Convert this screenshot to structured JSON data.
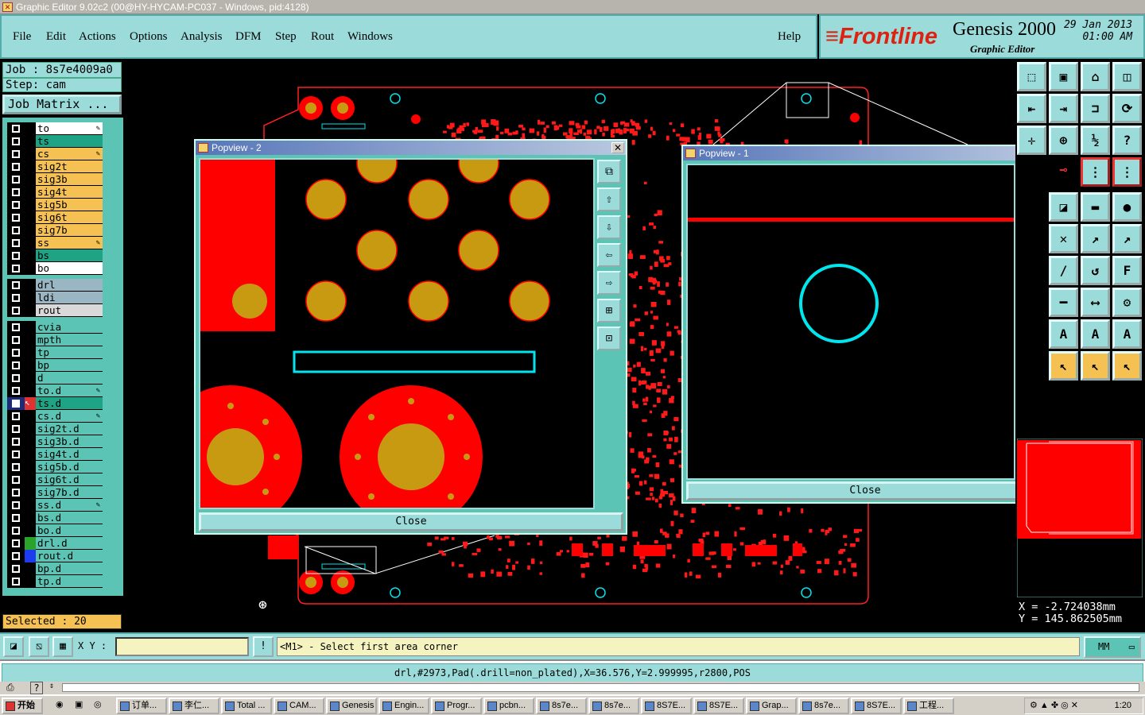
{
  "window": {
    "title": "Graphic Editor 9.02c2 (00@HY-HYCAM-PC037 - Windows, pid:4128)"
  },
  "menu": {
    "file": "File",
    "edit": "Edit",
    "actions": "Actions",
    "options": "Options",
    "analysis": "Analysis",
    "dfm": "DFM",
    "step": "Step",
    "rout": "Rout",
    "windows": "Windows",
    "help": "Help"
  },
  "brand": {
    "logo": "Frontline",
    "product": "Genesis 2000",
    "editor": "Graphic Editor",
    "date": "29 Jan 2013",
    "time": "01:00 AM"
  },
  "job": {
    "label": "Job : 8s7e4009a0",
    "step": "Step: cam",
    "matrix_button": "Job Matrix ..."
  },
  "layers_board": [
    {
      "name": "to",
      "color": "#ffffff",
      "pen": true
    },
    {
      "name": "ts",
      "color": "#1ea384",
      "pen": false
    },
    {
      "name": "cs",
      "color": "#f6c153",
      "pen": true
    },
    {
      "name": "sig2t",
      "color": "#f6c153",
      "pen": false
    },
    {
      "name": "sig3b",
      "color": "#f6c153",
      "pen": false
    },
    {
      "name": "sig4t",
      "color": "#f6c153",
      "pen": false
    },
    {
      "name": "sig5b",
      "color": "#f6c153",
      "pen": false
    },
    {
      "name": "sig6t",
      "color": "#f6c153",
      "pen": false
    },
    {
      "name": "sig7b",
      "color": "#f6c153",
      "pen": false
    },
    {
      "name": "ss",
      "color": "#f6c153",
      "pen": true
    },
    {
      "name": "bs",
      "color": "#1ea384",
      "pen": false
    },
    {
      "name": "bo",
      "color": "#ffffff",
      "pen": false
    }
  ],
  "layers_drill": [
    {
      "name": "drl",
      "color": "#9ab6c2"
    },
    {
      "name": "ldi",
      "color": "#9ab6c2"
    },
    {
      "name": "rout",
      "color": "#d9d9d9"
    }
  ],
  "layers_doc": [
    {
      "name": "cvia",
      "pen": false
    },
    {
      "name": "mpth",
      "pen": false
    },
    {
      "name": "tp",
      "pen": false
    },
    {
      "name": "bp",
      "pen": false
    },
    {
      "name": "d",
      "pen": false
    },
    {
      "name": "to.d",
      "pen": true
    },
    {
      "name": "ts.d",
      "pen": false,
      "active": true
    },
    {
      "name": "cs.d",
      "pen": true
    },
    {
      "name": "sig2t.d",
      "pen": false
    },
    {
      "name": "sig3b.d",
      "pen": false
    },
    {
      "name": "sig4t.d",
      "pen": false
    },
    {
      "name": "sig5b.d",
      "pen": false
    },
    {
      "name": "sig6t.d",
      "pen": false
    },
    {
      "name": "sig7b.d",
      "pen": false
    },
    {
      "name": "ss.d",
      "pen": true
    },
    {
      "name": "bs.d",
      "pen": false
    },
    {
      "name": "bo.d",
      "pen": false
    },
    {
      "name": "drl.d",
      "pen": false,
      "side": "#2aa32a"
    },
    {
      "name": "rout.d",
      "pen": false,
      "side": "#1c3cf0"
    },
    {
      "name": "bp.d",
      "pen": false
    },
    {
      "name": "tp.d",
      "pen": false
    }
  ],
  "selected": "Selected : 20",
  "popview2": {
    "title": "Popview - 2",
    "close": "Close"
  },
  "popview1": {
    "title": "Popview - 1",
    "close": "Close"
  },
  "coords": {
    "x": "X  =  -2.724038mm",
    "y": "Y  =  145.862505mm"
  },
  "status": {
    "xy_label": "X Y :",
    "xy_value": "",
    "prompt": "<M1> - Select first area corner",
    "units": "MM"
  },
  "info": "drl,#2973,Pad(.drill=non_plated),X=36.576,Y=2.999995,r2800,POS",
  "taskbar": {
    "start": "开始",
    "items": [
      "订单...",
      "李仁...",
      "Total ...",
      "CAM...",
      "Genesis",
      "Engin...",
      "Progr...",
      "pcbn...",
      "8s7e...",
      "8s7e...",
      "8S7E...",
      "8S7E...",
      "Grap...",
      "8s7e...",
      "8S7E...",
      "工程..."
    ],
    "time": "1:20"
  },
  "colors": {
    "panel": "#9bdcdb",
    "matrix": "#5cc4b5",
    "copper": "#ff0000",
    "pad": "#c89a12",
    "outline": "#00e5ee"
  }
}
